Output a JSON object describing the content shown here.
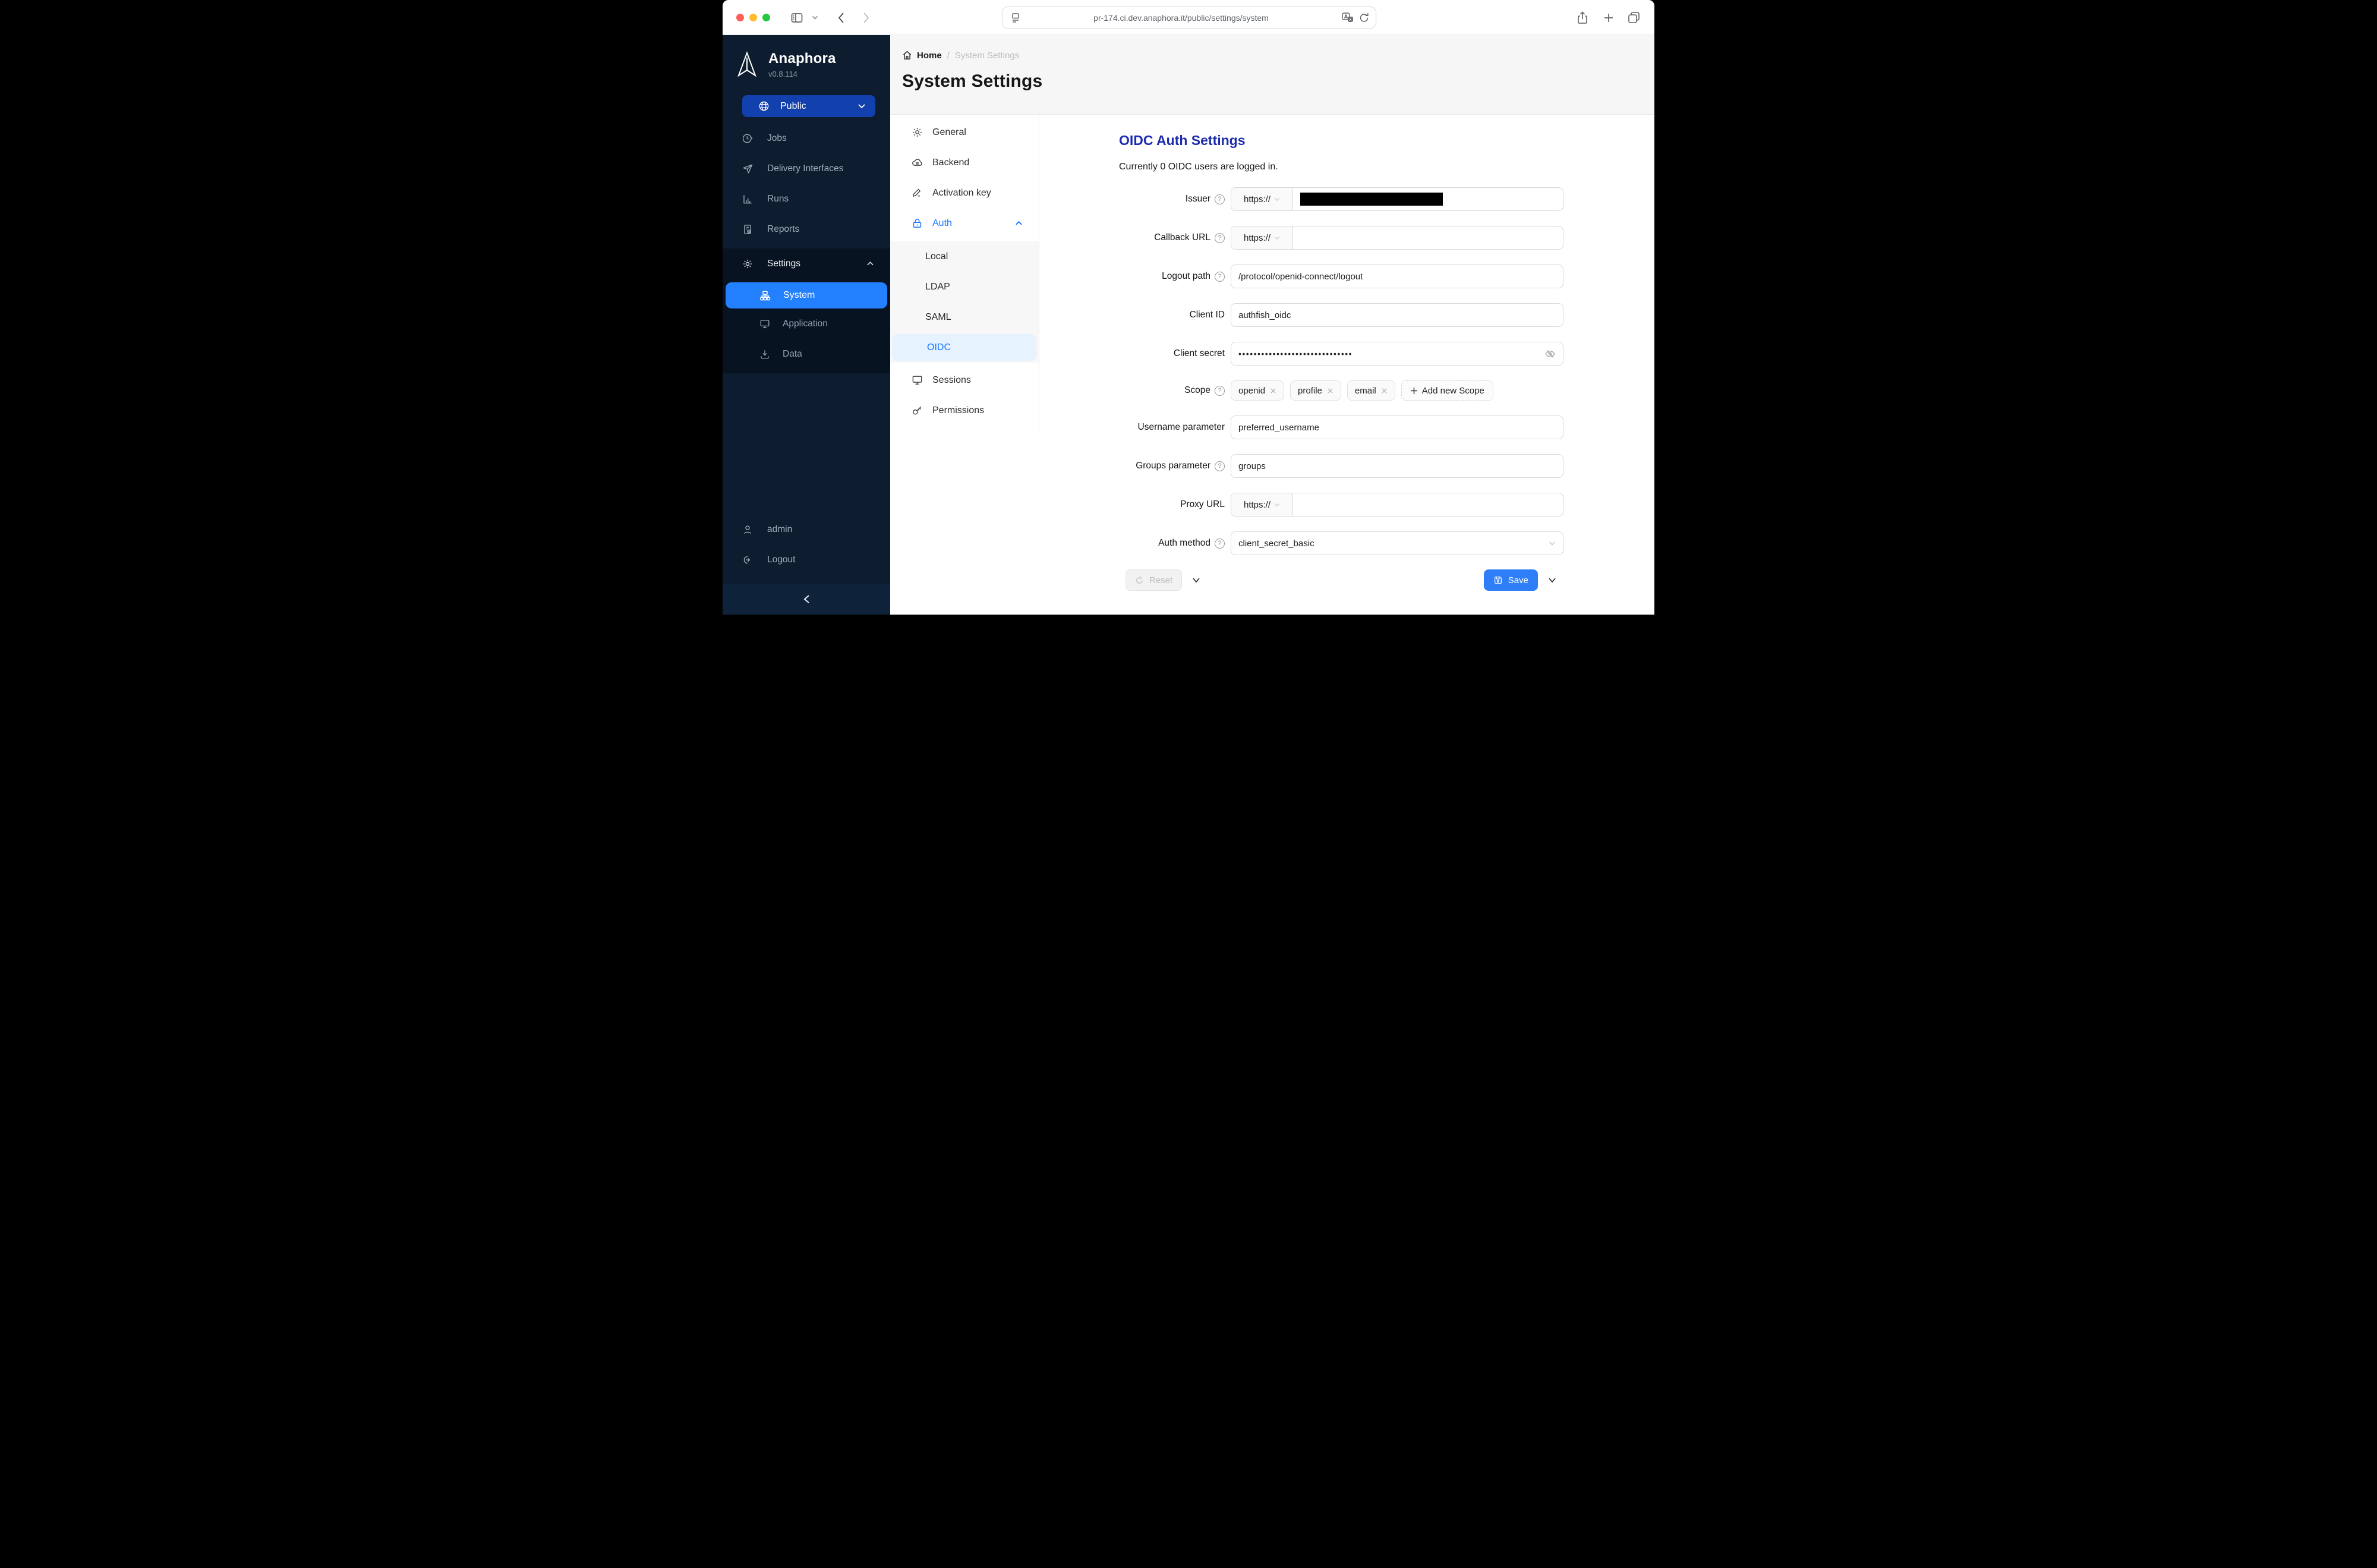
{
  "colors": {
    "workspace_blue": "#1240ad",
    "active_blue": "#2380ff",
    "link_blue": "#1677ff",
    "heading_blue": "#1d2cae",
    "save_blue": "#2e7ff7"
  },
  "browser": {
    "url": "pr-174.ci.dev.anaphora.it/public/settings/system"
  },
  "sidebar": {
    "brand": "Anaphora",
    "version": "v0.8.114",
    "workspace": "Public",
    "items": [
      "Jobs",
      "Delivery Interfaces",
      "Runs",
      "Reports",
      "Settings"
    ],
    "settings_children": [
      "System",
      "Application",
      "Data"
    ],
    "user": "admin",
    "logout": "Logout"
  },
  "breadcrumb": {
    "home": "Home",
    "separator": "/",
    "current": "System Settings"
  },
  "page": {
    "title": "System Settings"
  },
  "settings_nav": {
    "items": [
      "General",
      "Backend",
      "Activation key",
      "Auth"
    ],
    "auth_children": [
      "Local",
      "LDAP",
      "SAML",
      "OIDC"
    ],
    "bottom_items": [
      "Sessions",
      "Permissions"
    ]
  },
  "form": {
    "heading": "OIDC Auth Settings",
    "status": "Currently 0 OIDC users are logged in.",
    "protocol": "https://",
    "fields": {
      "issuer": {
        "label": "Issuer"
      },
      "callback": {
        "label": "Callback URL",
        "value": ""
      },
      "logout_path": {
        "label": "Logout path",
        "value": "/protocol/openid-connect/logout"
      },
      "client_id": {
        "label": "Client ID",
        "value": "authfish_oidc"
      },
      "client_secret": {
        "label": "Client secret",
        "value_masked": "••••••••••••••••••••••••••••••"
      },
      "scope": {
        "label": "Scope",
        "chips": [
          "openid",
          "profile",
          "email"
        ],
        "add_label": "Add new Scope"
      },
      "username": {
        "label": "Username parameter",
        "value": "preferred_username"
      },
      "groups": {
        "label": "Groups parameter",
        "value": "groups"
      },
      "proxy": {
        "label": "Proxy URL",
        "value": ""
      },
      "auth_method": {
        "label": "Auth method",
        "value": "client_secret_basic"
      }
    },
    "buttons": {
      "reset": "Reset",
      "save": "Save"
    }
  }
}
